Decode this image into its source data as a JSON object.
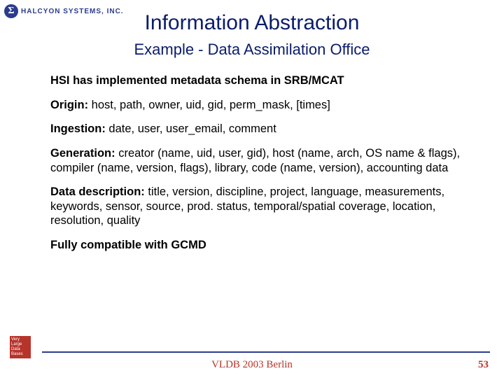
{
  "logo": {
    "sigma": "Σ",
    "company": "HALCYON SYSTEMS, INC."
  },
  "title": "Information Abstraction",
  "subtitle": "Example - Data Assimilation Office",
  "paragraphs": [
    {
      "lead": "",
      "text": "HSI has implemented metadata schema in SRB/MCAT",
      "fully_bold": true
    },
    {
      "lead": "Origin:",
      "text": " host, path, owner, uid, gid, perm_mask, [times]",
      "fully_bold": false
    },
    {
      "lead": "Ingestion:",
      "text": " date, user, user_email, comment",
      "fully_bold": false
    },
    {
      "lead": "Generation:",
      "text": " creator (name, uid, user, gid), host (name, arch, OS name & flags), compiler (name, version, flags), library, code (name, version), accounting data",
      "fully_bold": false
    },
    {
      "lead": "Data description:",
      "text": " title, version, discipline, project, language, measurements, keywords, sensor, source, prod. status, temporal/spatial coverage, location, resolution, quality",
      "fully_bold": false
    },
    {
      "lead": "",
      "text": "Fully compatible with GCMD",
      "fully_bold": true
    }
  ],
  "badge": {
    "l1": "Very",
    "l2": "Large",
    "l3": "Data",
    "l4": "Bases"
  },
  "footer": "VLDB 2003 Berlin",
  "page_number": "53"
}
